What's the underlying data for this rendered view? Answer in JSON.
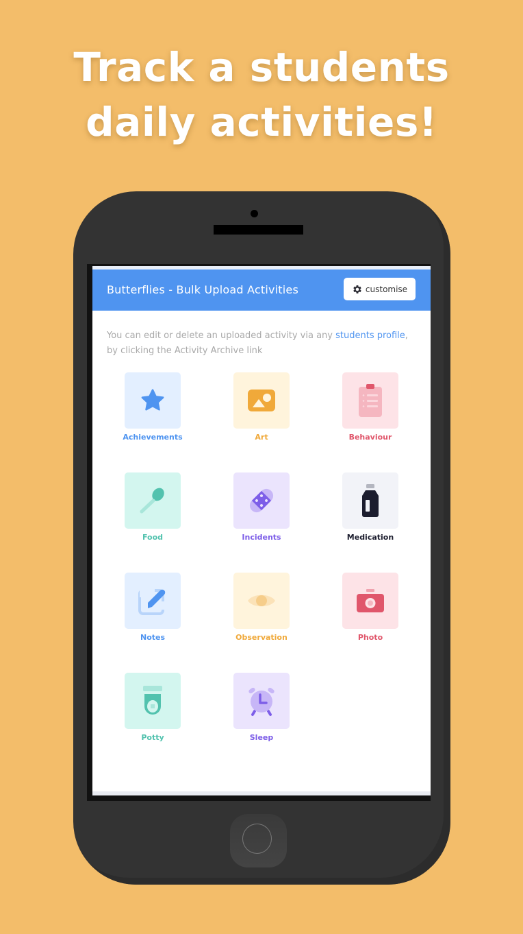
{
  "headline": {
    "line1": "Track a students",
    "line2": "daily activities!"
  },
  "app": {
    "title": "Butterflies - Bulk Upload Activities",
    "customise_label": "customise",
    "customise_icon": "gear-icon",
    "description_pre": "You can edit or delete an uploaded activity via any ",
    "description_link": "students profile",
    "description_post": ", by clicking the Activity Archive link"
  },
  "activities": [
    {
      "label": "Achievements",
      "icon": "star-icon",
      "color": "#4f94f0",
      "bg": "#e3efff"
    },
    {
      "label": "Art",
      "icon": "image-icon",
      "color": "#f0a93a",
      "bg": "#fff4dc"
    },
    {
      "label": "Behaviour",
      "icon": "clipboard-icon",
      "color": "#e0566b",
      "bg": "#fde3e7"
    },
    {
      "label": "Food",
      "icon": "spoon-icon",
      "color": "#52c2ae",
      "bg": "#d3f6ef"
    },
    {
      "label": "Incidents",
      "icon": "bandage-icon",
      "color": "#7d5ee8",
      "bg": "#ebe4fd"
    },
    {
      "label": "Medication",
      "icon": "medicine-bottle-icon",
      "color": "#1c1d2e",
      "bg": "#f2f3f8"
    },
    {
      "label": "Notes",
      "icon": "edit-note-icon",
      "color": "#4f94f0",
      "bg": "#e3efff"
    },
    {
      "label": "Observation",
      "icon": "eye-icon",
      "color": "#f0a93a",
      "bg": "#fff4dc"
    },
    {
      "label": "Photo",
      "icon": "camera-icon",
      "color": "#e0566b",
      "bg": "#fde3e7"
    },
    {
      "label": "Potty",
      "icon": "toilet-icon",
      "color": "#52c2ae",
      "bg": "#d3f6ef"
    },
    {
      "label": "Sleep",
      "icon": "alarm-clock-icon",
      "color": "#7d5ee8",
      "bg": "#ebe4fd"
    }
  ]
}
